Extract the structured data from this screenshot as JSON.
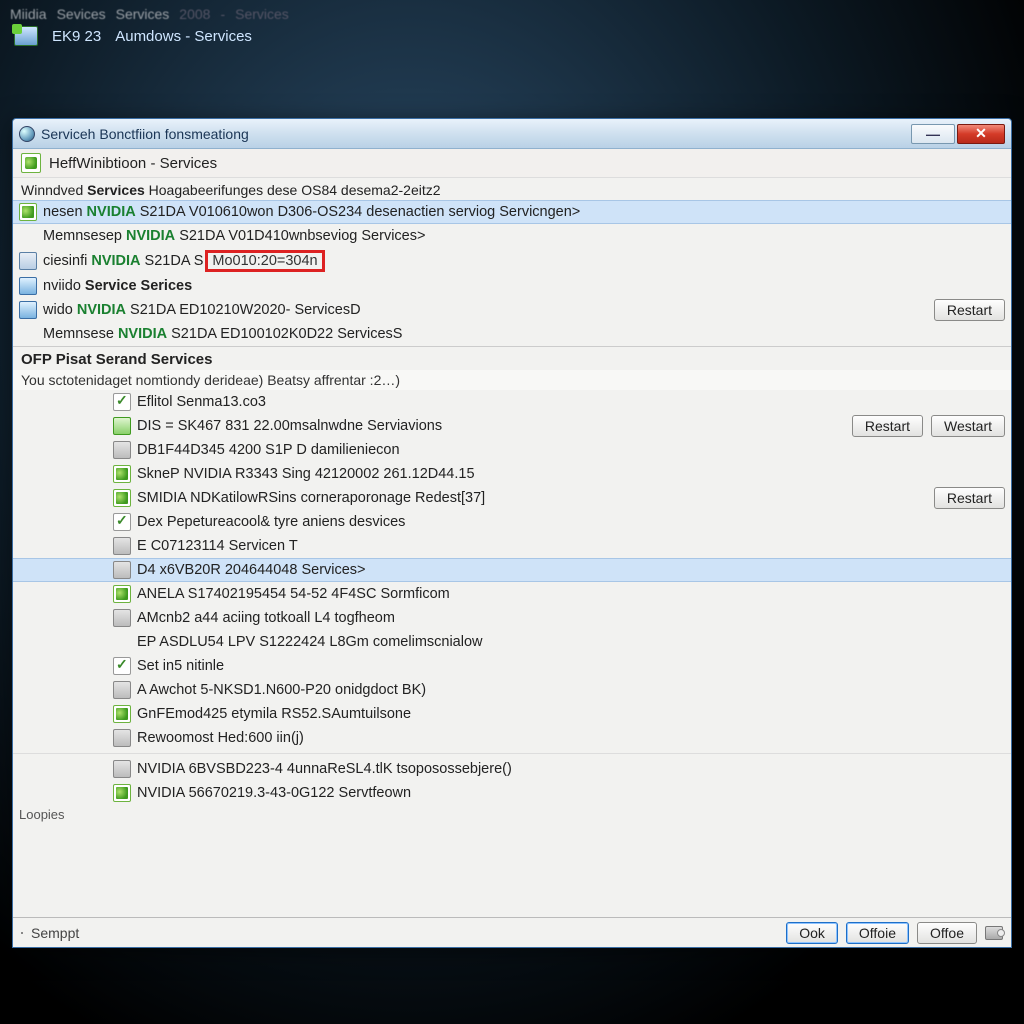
{
  "crumb": {
    "a": "Miidia",
    "b": "Sevices",
    "c": "Services",
    "d": "2008",
    "e": "Services"
  },
  "taskstrip": {
    "badge": "EK9 23",
    "label": "Aumdows - Services"
  },
  "window": {
    "title": "Serviceh Bonctfiion fonsmeationg",
    "subtitle": "HeffWinibtioon - Services"
  },
  "top_header_prefix": "Winndved ",
  "top_header_bold": "Services",
  "top_header_rest": " Hoagabeerifunges dese OS84 desema2-2eitz2",
  "top_items": [
    {
      "icon": "nv",
      "prefix": "nesen ",
      "nv": "NVIDIA",
      "rest": " S21DA V010610won D306-OS234 desenactien serviog Servicngen>",
      "sel": true
    },
    {
      "icon": "",
      "prefix": "Memnsesep ",
      "nv": "NVIDIA",
      "rest": " S21DA V01D410wnbseviog Services>"
    },
    {
      "icon": "cyl",
      "prefix": "ciesinfi ",
      "nv": "NVIDIA",
      "rest": " S21DA S",
      "box": "Mo010:20=304n"
    },
    {
      "icon": "blue",
      "prefix": "nviido ",
      "bold": "Service Serices",
      "rest": ""
    },
    {
      "icon": "blue",
      "prefix": " wido ",
      "nv": "NVIDIA",
      "rest": " S21DA ED10210W2020- ServicesD",
      "btns": [
        "Restart"
      ]
    },
    {
      "icon": "",
      "prefix": "Memnsese ",
      "nv": "NVIDIA",
      "rest": " S21DA ED100102K0D22 ServicesS"
    }
  ],
  "sec2_header": "OFP Pisat Serand Services",
  "sec2_hint": "You sctotenidaget nomtiondy derideae) Beatsy affrentar :2…)",
  "sec2_items": [
    {
      "icon": "chk",
      "text": "Eflitol Senma13.co3"
    },
    {
      "icon": "green",
      "text": "DIS = SK467 831 22.00msalnwdne Serviavions",
      "btns": [
        "Restart",
        "Westart"
      ]
    },
    {
      "icon": "grey",
      "text": "DB1F44D345 4200 S1P  D damilieniecon"
    },
    {
      "icon": "nv",
      "text": "SkneP NVIDIA R3343 Sing 42120002 261.12D44.15"
    },
    {
      "icon": "nv",
      "text": "SMIDIA NDKatilowRSins corneraporonage Redest[37]",
      "btns": [
        "Restart"
      ]
    },
    {
      "icon": "chk",
      "text": "Dex Pepetureacool& tyre aniens desvices"
    },
    {
      "icon": "grey",
      "text": "E C07123114 Servicen T"
    },
    {
      "icon": "grey",
      "text": "D4 x6VB20R 204644048 Services>",
      "sel": true
    },
    {
      "icon": "nv",
      "text": "ANELA S17402195454 54-52 4F4SC Sormficom"
    },
    {
      "icon": "grey",
      "text": "AMcnb2 a44 aciing totkoall L4 togfheom"
    },
    {
      "icon": "",
      "text": "EP ASDLU54 LPV S1222424 L8Gm comelimscnialow"
    },
    {
      "icon": "chk",
      "text": "Set in5 nitinle"
    },
    {
      "icon": "grey",
      "text": "A Awchot 5-NKSD1.N600-P20 onidgdoct BK)"
    },
    {
      "icon": "nv",
      "text": "GnFEmod425 etymila RS52.SAumtuilsone"
    },
    {
      "icon": "grey",
      "text": "Rewoomost Hed:600 iin(j)"
    },
    {
      "icon": "grey",
      "text": "NVIDIA 6BVSBD223-4 4unnaReSL4.tlK tsoposossebjere()",
      "divider_before": true
    },
    {
      "icon": "nv",
      "text": "NVIDIA 56670219.3-43-0G122 Servtfeown"
    }
  ],
  "footer": {
    "loopies": "Loopies",
    "sempt": "Semppt",
    "ok": "Ook",
    "office1": "Offoie",
    "office2": "Offoe"
  }
}
